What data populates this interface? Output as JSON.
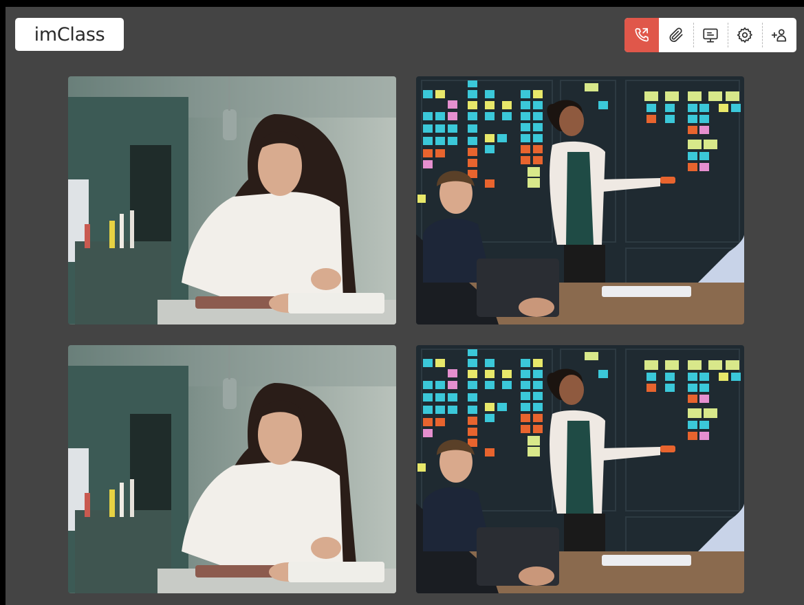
{
  "app": {
    "logo_text": "imClass"
  },
  "toolbar": {
    "buttons": [
      {
        "icon": "phone-call-icon",
        "active": true,
        "color": "#e0574a"
      },
      {
        "icon": "paperclip-icon",
        "active": false
      },
      {
        "icon": "screen-share-icon",
        "active": false
      },
      {
        "icon": "settings-gear-icon",
        "active": false
      },
      {
        "icon": "add-participant-icon",
        "active": false
      }
    ]
  },
  "video_grid": {
    "tiles": [
      {
        "subject": "student-writing"
      },
      {
        "subject": "presenter-at-board"
      },
      {
        "subject": "student-writing"
      },
      {
        "subject": "presenter-at-board"
      }
    ]
  },
  "colors": {
    "background": "#444444",
    "accent": "#e0574a"
  }
}
